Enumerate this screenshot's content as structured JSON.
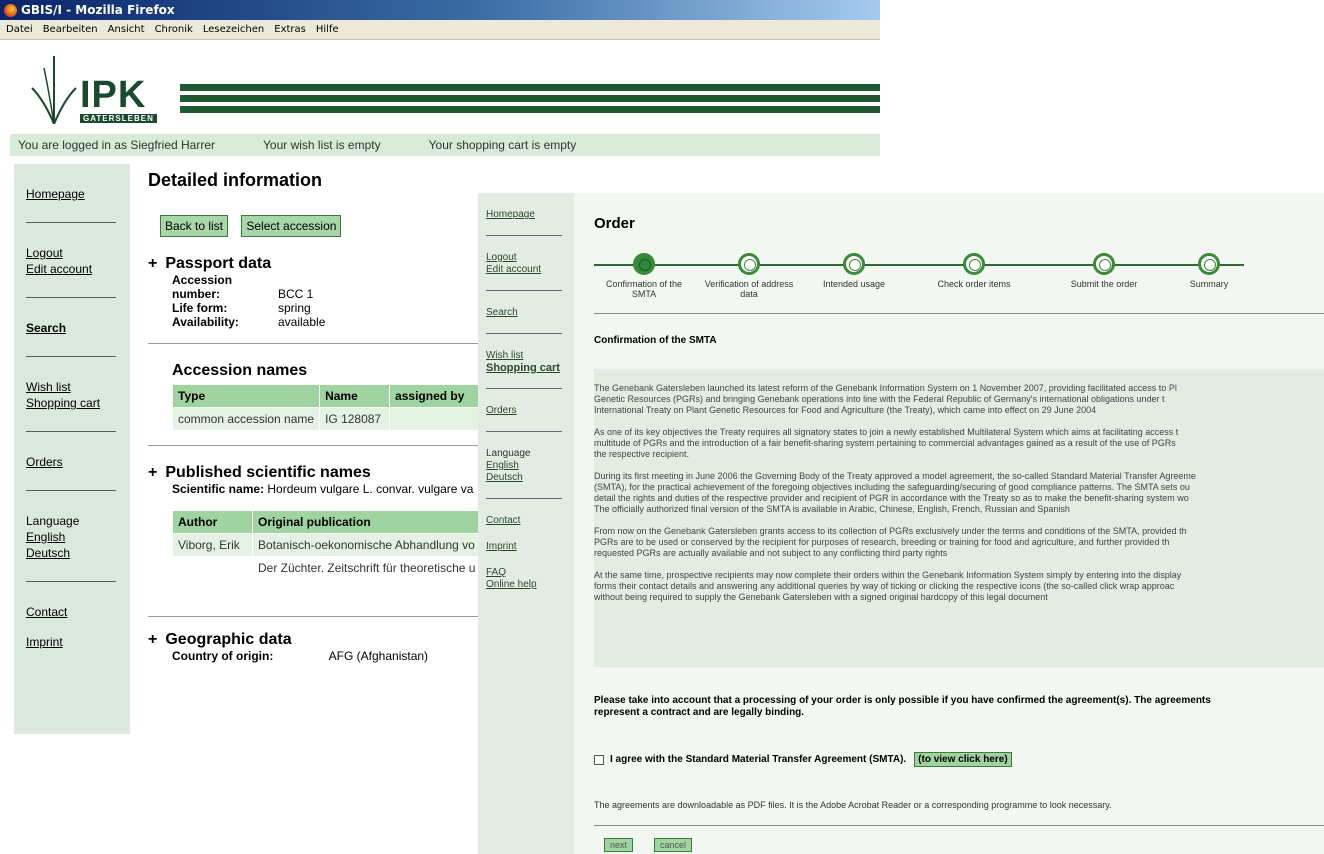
{
  "back": {
    "window_title": "GBIS/I - Mozilla Firefox",
    "menu": [
      "Datei",
      "Bearbeiten",
      "Ansicht",
      "Chronik",
      "Lesezeichen",
      "Extras",
      "Hilfe"
    ],
    "logo_word": "IPK",
    "logo_sub": "GATERSLEBEN",
    "status": {
      "logged_in": "You are logged in as Siegfried Harrer",
      "wish_list": "Your wish list is empty",
      "cart": "Your shopping cart is empty"
    },
    "nav": {
      "homepage": "Homepage",
      "logout": "Logout",
      "edit_account": "Edit account",
      "search": "Search",
      "wish_list": "Wish list",
      "shopping_cart": "Shopping cart",
      "orders": "Orders",
      "language": "Language",
      "english": "English",
      "deutsch": "Deutsch",
      "contact": "Contact",
      "imprint": "Imprint"
    },
    "page_title": "Detailed information",
    "buttons": {
      "back_to_list": "Back to list",
      "select_accession": "Select accession"
    },
    "passport": {
      "heading": "Passport data",
      "rows": [
        {
          "k": "Accession number:",
          "v": "BCC 1"
        },
        {
          "k": "Life form:",
          "v": "spring"
        },
        {
          "k": "Availability:",
          "v": "available"
        }
      ]
    },
    "accession_names": {
      "heading": "Accession names",
      "headers": [
        "Type",
        "Name",
        "assigned by"
      ],
      "row": [
        "common accession name",
        "IG 128087",
        ""
      ]
    },
    "sci_names": {
      "heading": "Published scientific names",
      "label": "Scientific name:",
      "value": "Hordeum vulgare L. convar. vulgare va",
      "headers": [
        "Author",
        "Original publication"
      ],
      "rows": [
        [
          "Viborg, Erik",
          "Botanisch-oekonomische Abhandlung vo"
        ],
        [
          "",
          "Der Züchter. Zeitschrift für theoretische u"
        ]
      ]
    },
    "geo": {
      "heading": "Geographic data",
      "label": "Country of origin:",
      "value": "AFG (Afghanistan)"
    }
  },
  "front": {
    "nav": {
      "homepage": "Homepage",
      "logout": "Logout",
      "edit_account": "Edit account",
      "search": "Search",
      "wish_list": "Wish list",
      "shopping_cart": "Shopping cart",
      "orders": "Orders",
      "language": "Language",
      "english": "English",
      "deutsch": "Deutsch",
      "contact": "Contact",
      "imprint": "Imprint",
      "faq": "FAQ",
      "online_help": "Online help"
    },
    "title": "Order",
    "steps": [
      "Confirmation of the SMTA",
      "Verification of address data",
      "Intended usage",
      "Check order items",
      "Submit the order",
      "Summary"
    ],
    "subtitle": "Confirmation of the SMTA",
    "paragraphs": [
      "The Genebank Gatersleben launched its latest reform of the Genebank Information System on 1 November 2007, providing facilitated access to Pl",
      "Genetic Resources (PGRs) and bringing Genebank operations into line with the Federal Republic of Germany's international obligations under t",
      "International Treaty on Plant Genetic Resources for Food and Agriculture (the Treaty), which came into effect on 29 June 2004",
      "As one of its key objectives the Treaty requires all signatory states to join a newly established Multilateral System which aims at facilitating access t",
      "multitude of PGRs and the introduction of a fair benefit-sharing system pertaining to commercial advantages gained as a result of the use of PGRs",
      "the respective recipient.",
      "During its first meeting in June 2006 the Governing Body of the Treaty approved a model agreement, the so-called Standard Material Transfer Agreeme",
      "(SMTA), for the practical achievement of the foregoing objectives including the safeguarding/securing of good compliance patterns. The SMTA sets ou",
      "detail the rights and duties of the respective provider and recipient of PGR in accordance with the Treaty so as to make the benefit-sharing system wo",
      "The officially authorized final version of the SMTA is available in Arabic, Chinese, English, French, Russian and Spanish",
      "From now on the Genebank Gatersleben grants access to its collection of PGRs exclusively under the terms and conditions of the SMTA, provided th",
      "PGRs are to be used or conserved by the recipient for purposes of research, breeding or training for food and agriculture, and further provided th",
      "requested PGRs are actually available and not subject to any conflicting third party rights",
      "At the same time, prospective recipients may now complete their orders within the Genebank Information System simply by entering into the display",
      "forms their contact details and answering any additional queries by way of ticking or clicking the respective icons (the so-called click wrap approac",
      "without being required to supply the Genebank Gatersleben with a signed original hardcopy of this legal document"
    ],
    "notice_1": "Please take into account that a processing of your order is only possible if you have confirmed the agreement(s). The agreements",
    "notice_2": "represent a contract and are legally binding.",
    "agree_label": "I agree with the Standard Material Transfer Agreement (SMTA).",
    "view_link": "(to view click here)",
    "download_note": "The agreements are downloadable as PDF files. It is the Adobe Acrobat Reader or a corresponding programme to look necessary.",
    "next": "next",
    "cancel": "cancel"
  }
}
